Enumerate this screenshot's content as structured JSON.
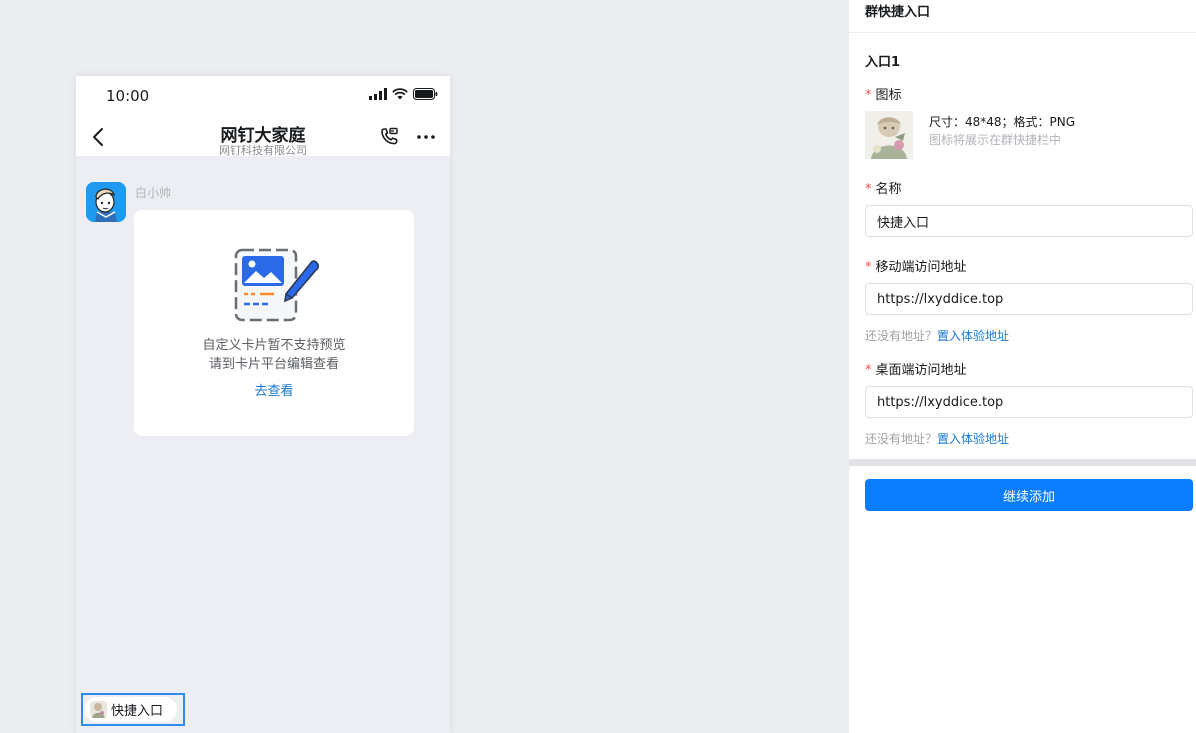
{
  "phone": {
    "status_time": "10:00",
    "nav": {
      "title": "网钉大家庭",
      "subtitle": "网钉科技有限公司"
    },
    "message": {
      "sender": "白小帅",
      "card": {
        "line1": "自定义卡片暂不支持预览",
        "line2": "请到卡片平台编辑查看",
        "link": "去查看"
      }
    },
    "shortcut": {
      "label": "快捷入口"
    }
  },
  "panel": {
    "title": "群快捷入口",
    "entry_title": "入口1",
    "icon_field": {
      "label": "图标",
      "spec": "尺寸：48*48；格式：PNG",
      "hint": "图标将展示在群快捷栏中"
    },
    "name_field": {
      "label": "名称",
      "value": "快捷入口"
    },
    "mobile_field": {
      "label": "移动端访问地址",
      "value": "https://lxyddice.top",
      "hint_prefix": "还没有地址？",
      "hint_link": "置入体验地址"
    },
    "desktop_field": {
      "label": "桌面端访问地址",
      "value": "https://lxyddice.top",
      "hint_prefix": "还没有地址？",
      "hint_link": "置入体验地址"
    },
    "add_button": "继续添加",
    "required_mark": "*"
  },
  "colors": {
    "accent": "#0a7cff",
    "link": "#1779d1",
    "required": "#ff4d4f"
  },
  "icons": [
    "signal-icon",
    "wifi-icon",
    "battery-icon",
    "back-icon",
    "phone-icon",
    "more-icon"
  ]
}
